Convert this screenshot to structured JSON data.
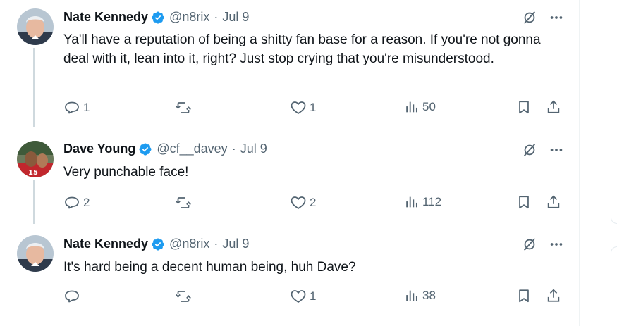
{
  "tweets": [
    {
      "name": "Nate Kennedy",
      "handle": "@n8rix",
      "separator": "·",
      "date": "Jul 9",
      "text": "Ya'll have a reputation of being a shitty fan base for a reason. If you're not gonna deal with it, lean into it, right? Just stop crying that you're misunderstood.",
      "replies": "1",
      "retweets": "",
      "likes": "1",
      "views": "50"
    },
    {
      "name": "Dave Young",
      "handle": "@cf__davey",
      "separator": "·",
      "date": "Jul 9",
      "text": "Very punchable face!",
      "replies": "2",
      "retweets": "",
      "likes": "2",
      "views": "112"
    },
    {
      "name": "Nate Kennedy",
      "handle": "@n8rix",
      "separator": "·",
      "date": "Jul 9",
      "text": "It's hard being a decent human being, huh Dave?",
      "replies": "",
      "retweets": "",
      "likes": "1",
      "views": "38"
    }
  ],
  "icons": {
    "verified": "verified-badge-icon",
    "grok": "grok-icon",
    "more": "more-icon",
    "reply": "reply-icon",
    "retweet": "retweet-icon",
    "like": "like-icon",
    "views": "views-icon",
    "bookmark": "bookmark-icon",
    "share": "share-icon"
  },
  "colors": {
    "verified": "#1d9bf0",
    "text": "#0f1419",
    "muted": "#536471",
    "thread_line": "#cfd9de"
  }
}
